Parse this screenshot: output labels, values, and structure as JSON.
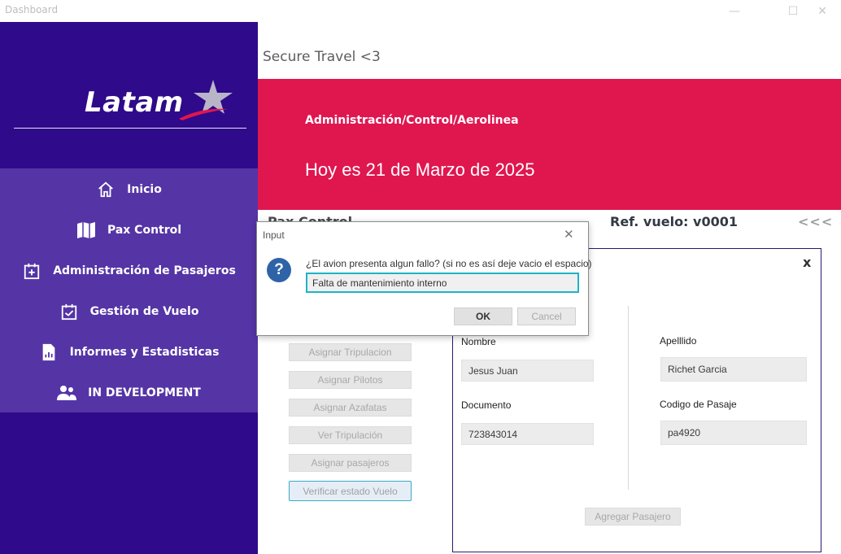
{
  "window": {
    "title": "Dashboard",
    "minimize": "—",
    "maximize": "☐",
    "close": "✕"
  },
  "brand": {
    "logo_text": "Latam"
  },
  "sidebar": {
    "items": [
      {
        "label": "Inicio",
        "icon": "home-icon"
      },
      {
        "label": "Pax Control",
        "icon": "book-map-icon"
      },
      {
        "label": "Administración de Pasajeros",
        "icon": "calendar-add-icon"
      },
      {
        "label": "Gestión de Vuelo",
        "icon": "calendar-check-icon"
      },
      {
        "label": "Informes y Estadisticas",
        "icon": "report-file-icon"
      },
      {
        "label": "IN DEVELOPMENT",
        "icon": "people-icon"
      }
    ]
  },
  "header": {
    "text": "Secure Travel <3"
  },
  "banner": {
    "breadcrumb": "Administración/Control/Aerolinea",
    "date_text": "Hoy es 21 de Marzo de 2025"
  },
  "section": {
    "title": "Pax Control",
    "ref_label": "Ref. vuelo: v0001",
    "back": "<<<"
  },
  "actions": [
    "Asignar Tripulacion",
    "Asignar Pilotos",
    "Asignar Azafatas",
    "Ver Tripulación",
    "Asignar pasajeros",
    "Verificar estado Vuelo"
  ],
  "form": {
    "close": "x",
    "nombre_label": "Nombre",
    "nombre_value": "Jesus Juan",
    "apellido_label": "Apelllido",
    "apellido_value": "Richet Garcia",
    "documento_label": "Documento",
    "documento_value": "723843014",
    "codigo_label": "Codigo de Pasaje",
    "codigo_value": "pa4920",
    "add_button": "Agregar Pasajero"
  },
  "dialog": {
    "title": "Input",
    "close": "✕",
    "icon_glyph": "?",
    "message": "¿El avion presenta algun fallo? (si no es así deje vacio el espacio)",
    "input_value": "Falta de mantenimiento interno",
    "ok_label": "OK",
    "cancel_label": "Cancel"
  },
  "colors": {
    "sidebar_bg": "#2f0a8a",
    "menu_bg": "#5534a6",
    "banner_bg": "#e0164f",
    "input_focus": "#1eb3c7"
  }
}
